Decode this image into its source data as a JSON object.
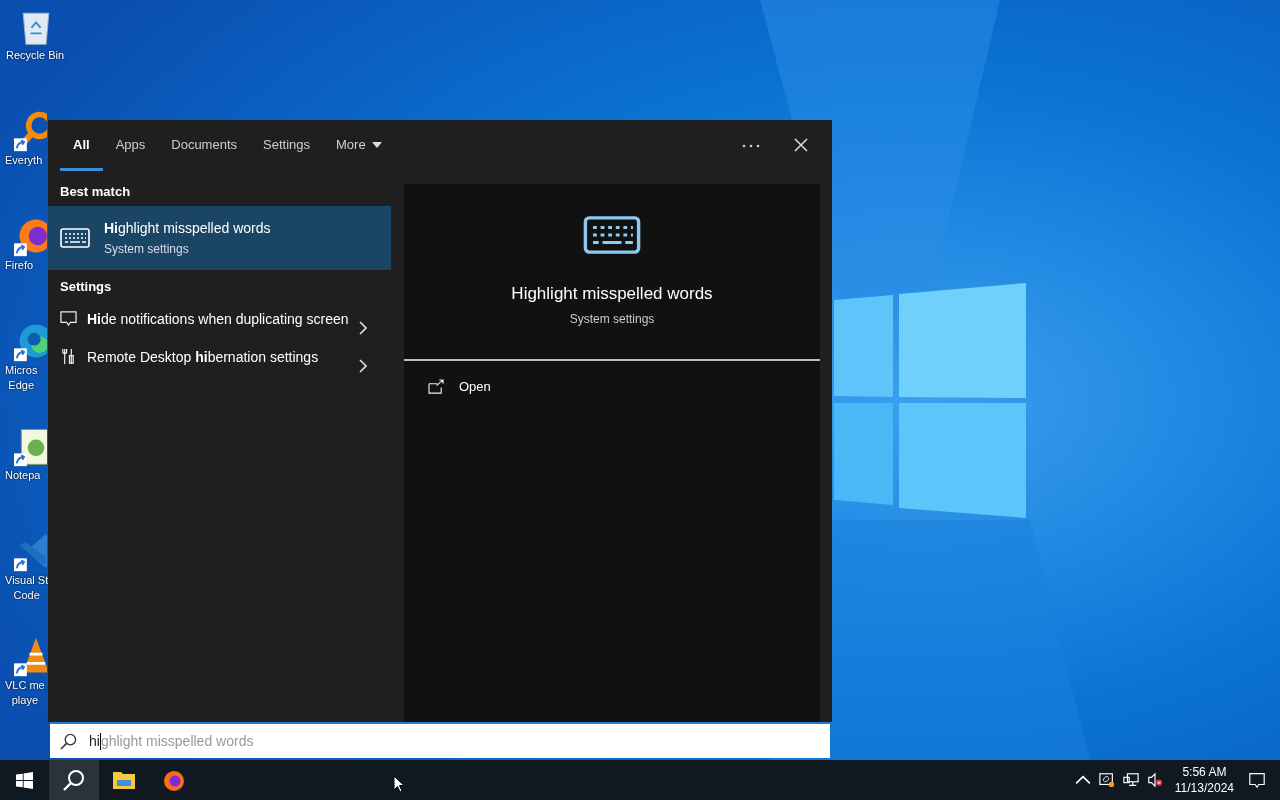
{
  "desktop_icons": [
    {
      "kind": "recycle",
      "shortcut": false,
      "label_lines": [
        "Recycle Bin"
      ]
    },
    {
      "kind": "magnifier",
      "shortcut": true,
      "label_lines": [
        "Everyth"
      ]
    },
    {
      "kind": "firefox",
      "shortcut": true,
      "label_lines": [
        "Firefo"
      ]
    },
    {
      "kind": "edge",
      "shortcut": true,
      "label_lines": [
        "Micros",
        "Edge"
      ]
    },
    {
      "kind": "notepad",
      "shortcut": true,
      "label_lines": [
        "Notepa"
      ]
    },
    {
      "kind": "vscode",
      "shortcut": true,
      "label_lines": [
        "Visual St",
        "Code"
      ]
    },
    {
      "kind": "vlc",
      "shortcut": true,
      "label_lines": [
        "VLC me",
        "playe"
      ]
    }
  ],
  "search_panel": {
    "tabs": [
      {
        "label": "All",
        "selected": true,
        "kind": "plain"
      },
      {
        "label": "Apps",
        "selected": false,
        "kind": "plain"
      },
      {
        "label": "Documents",
        "selected": false,
        "kind": "plain"
      },
      {
        "label": "Settings",
        "selected": false,
        "kind": "plain"
      },
      {
        "label": "More",
        "selected": false,
        "kind": "dropdown"
      }
    ],
    "best_match": {
      "heading": "Best match",
      "title": "**Hi**ghlight misspelled words",
      "subtitle": "System settings",
      "selected": true
    },
    "settings_section": {
      "heading": "Settings",
      "items": [
        {
          "title": "**Hi**de notifications when duplicating screen",
          "kind": "notification"
        },
        {
          "title": "Remote Desktop **hi**bernation settings",
          "kind": "tools"
        }
      ]
    },
    "preview": {
      "title": "Highlight misspelled words",
      "subtitle": "System settings",
      "actions": [
        {
          "label": "Open"
        }
      ]
    },
    "search_box": {
      "value": "hi",
      "suggestion": "ghlight misspelled words"
    }
  },
  "taskbar": {
    "apps": [
      {
        "kind": "search",
        "selected": true
      },
      {
        "kind": "explorer",
        "selected": false
      },
      {
        "kind": "firefox",
        "selected": false
      }
    ],
    "clock": {
      "time": "5:56 AM",
      "date": "11/13/2024"
    }
  }
}
